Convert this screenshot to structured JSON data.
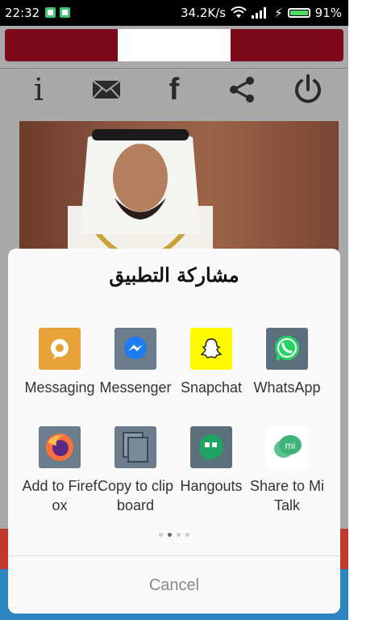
{
  "status_bar": {
    "time": "22:32",
    "speed": "34.2K/s",
    "battery": "91%",
    "battery_level": 0.91
  },
  "toolbar": {
    "icons": [
      "info-icon",
      "mail-icon",
      "facebook-icon",
      "share-icon",
      "power-icon"
    ],
    "info_glyph": "i",
    "facebook_glyph": "f"
  },
  "share_sheet": {
    "title": "مشاركة التطبيق",
    "apps": [
      {
        "label": "Messaging",
        "icon": "messaging-icon",
        "color": "#e8a23a"
      },
      {
        "label": "Messenger",
        "icon": "messenger-icon",
        "color": "#6b7d8c"
      },
      {
        "label": "Snapchat",
        "icon": "snapchat-icon",
        "color": "#fffc00"
      },
      {
        "label": "WhatsApp",
        "icon": "whatsapp-icon",
        "color": "#5c6f7c"
      },
      {
        "label": "Add to Firefox",
        "icon": "firefox-icon",
        "color": "#6b7d8c"
      },
      {
        "label": "Copy to clipboard",
        "icon": "clipboard-icon",
        "color": "#6b7d8c"
      },
      {
        "label": "Hangouts",
        "icon": "hangouts-icon",
        "color": "#5c6f7c"
      },
      {
        "label": "Share to Mi Talk",
        "icon": "mitalk-icon",
        "color": "#ffffff"
      }
    ],
    "cancel_label": "Cancel",
    "page_count": 4,
    "active_page": 2
  },
  "colors": {
    "flag_maroon": "#7d0a1a",
    "sheet_bg": "#fafafa",
    "ad_blue": "#2e86c1",
    "bottom_red": "#c0392b"
  }
}
